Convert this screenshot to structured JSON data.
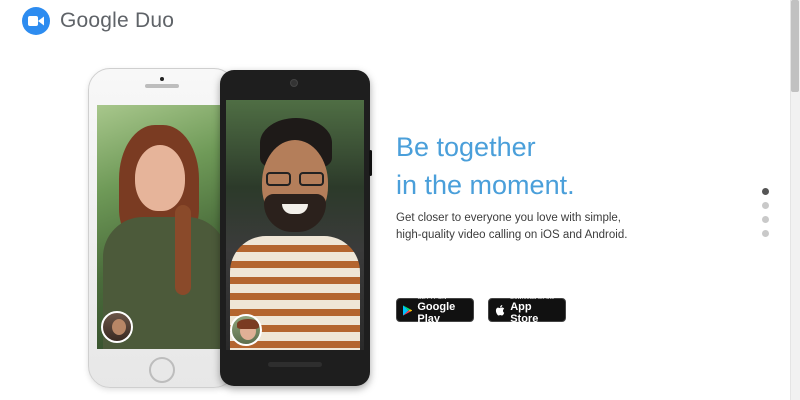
{
  "header": {
    "brand": "Google Duo",
    "logo_icon": "video-camera-icon",
    "logo_color": "#2d8cf0"
  },
  "hero": {
    "headline_line1": "Be together",
    "headline_line2": "in the moment.",
    "subtext": "Get closer to everyone you love with simple, high-quality video calling on iOS and Android.",
    "headline_color": "#4a9fda"
  },
  "stores": {
    "google_play": {
      "small": "GET IT ON",
      "big": "Google Play",
      "icon": "play-triangle-icon"
    },
    "app_store": {
      "small": "Download on the",
      "big": "App Store",
      "icon": "apple-icon"
    }
  },
  "carousel": {
    "slides": 4,
    "active_index": 0
  }
}
